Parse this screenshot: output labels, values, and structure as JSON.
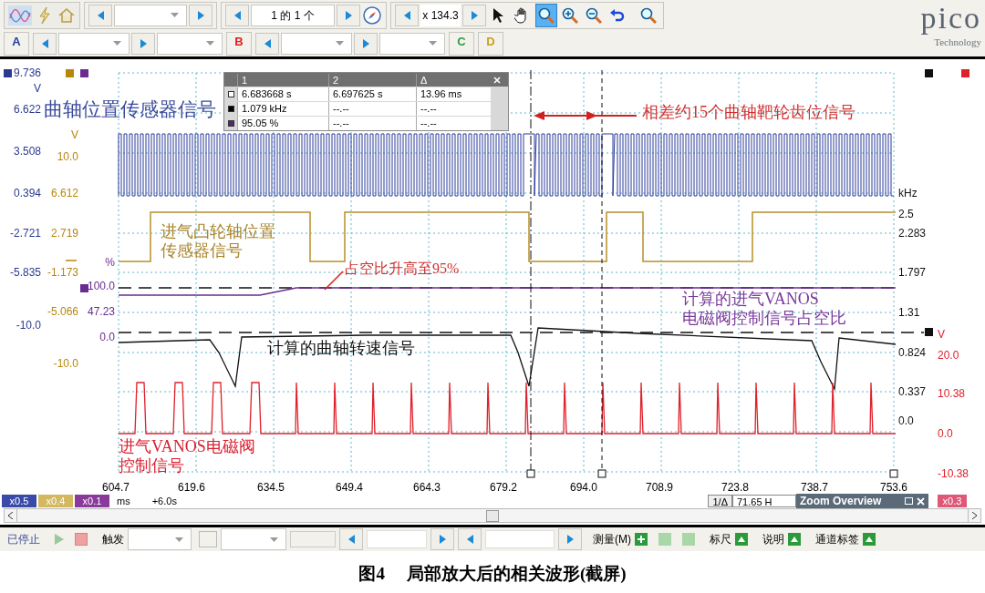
{
  "toolbar": {
    "page_counter": "1 的 1 个",
    "zoom_factor": "x 134.3",
    "tools": [
      {
        "kind": "pointer",
        "selected": false
      },
      {
        "kind": "hand",
        "selected": false
      },
      {
        "kind": "zoom-region",
        "selected": true
      },
      {
        "kind": "zoom-in",
        "selected": false
      },
      {
        "kind": "zoom-out",
        "selected": false
      },
      {
        "kind": "undo",
        "selected": false
      },
      {
        "kind": "zoom-fit",
        "selected": false
      }
    ]
  },
  "channels": [
    {
      "label": "A",
      "color": "#1f3fa0"
    },
    {
      "label": "B",
      "color": "#e02020"
    },
    {
      "label": "C",
      "color": "#2e9e3e"
    },
    {
      "label": "D",
      "color": "#c8a020"
    }
  ],
  "logo": {
    "name": "pico",
    "tagline": "Technology"
  },
  "scales": [
    {
      "color": "#2b3a8f",
      "labels": [
        "9.736",
        "V",
        "6.622",
        "3.508",
        "0.394",
        "-2.721",
        "-5.835",
        "-10.0"
      ]
    },
    {
      "color": "#b8860b",
      "labels": [
        "V",
        "10.0",
        "6.612",
        "2.719",
        "-1.173",
        "-5.066",
        "-10.0"
      ]
    },
    {
      "color": "#6a2c91",
      "labels": [
        "%",
        "100.0",
        "47.23",
        "0.0"
      ]
    },
    {
      "color": "#111111",
      "labels": [
        "kHz",
        "2.5",
        "2.283",
        "1.797",
        "1.31",
        "0.824",
        "0.337",
        "0.0"
      ]
    },
    {
      "color": "#e0202a",
      "labels": [
        "V",
        "20.0",
        "10.38",
        "0.0",
        "-10.38"
      ]
    }
  ],
  "x_axis": {
    "ticks": [
      "604.7",
      "619.6",
      "634.5",
      "649.4",
      "664.3",
      "679.2",
      "694.0",
      "708.9",
      "723.8",
      "738.7",
      "753.6"
    ],
    "unit": "ms",
    "offset": "+6.0s"
  },
  "scale_chips": [
    {
      "label": "x0.5",
      "color": "#3a4aa8"
    },
    {
      "label": "x0.4",
      "color": "#d4b860"
    },
    {
      "label": "x0.1",
      "color": "#8a3a9a"
    },
    {
      "label": "x0.3",
      "color": "#e05878"
    }
  ],
  "measurements": {
    "columns": [
      "1",
      "2",
      "Δ"
    ],
    "rows": [
      {
        "color": "#ffffff",
        "values": [
          "6.683668 s",
          "6.697625 s",
          "13.96 ms"
        ]
      },
      {
        "color": "#000000",
        "values": [
          "1.079 kHz",
          "--.--",
          "--.--"
        ]
      },
      {
        "color": "#4b2a7a",
        "values": [
          "95.05 %",
          "--.--",
          "--.--"
        ]
      }
    ]
  },
  "annotations": [
    {
      "lines": [
        "曲轴位置传感器信号"
      ],
      "color": "#3a4a9a"
    },
    {
      "lines": [
        "相差约15个曲轴靶轮齿位信号"
      ],
      "color": "#d03030"
    },
    {
      "lines": [
        "进气凸轮轴位置",
        "传感器信号"
      ],
      "color": "#a8842a"
    },
    {
      "lines": [
        "占空比升高至95%"
      ],
      "color": "#d03030"
    },
    {
      "lines": [
        "计算的进气VANOS",
        "电磁阀控制信号占空比"
      ],
      "color": "#7a3a9a"
    },
    {
      "lines": [
        "计算的曲轴转速信号"
      ],
      "color": "#111111"
    },
    {
      "lines": [
        "进气VANOS电磁阀",
        "控制信号"
      ],
      "color": "#d82030"
    }
  ],
  "zoom_bar": {
    "label": "1/Δ",
    "value": "71.65 H",
    "overview_title": "Zoom Overview"
  },
  "status_bar": {
    "state": "已停止",
    "trigger": "触发",
    "measure": "测量(M)",
    "items": [
      "标尺",
      "说明",
      "通道标签"
    ]
  },
  "caption": {
    "number": "图4",
    "text": "局部放大后的相关波形(截屏)"
  }
}
